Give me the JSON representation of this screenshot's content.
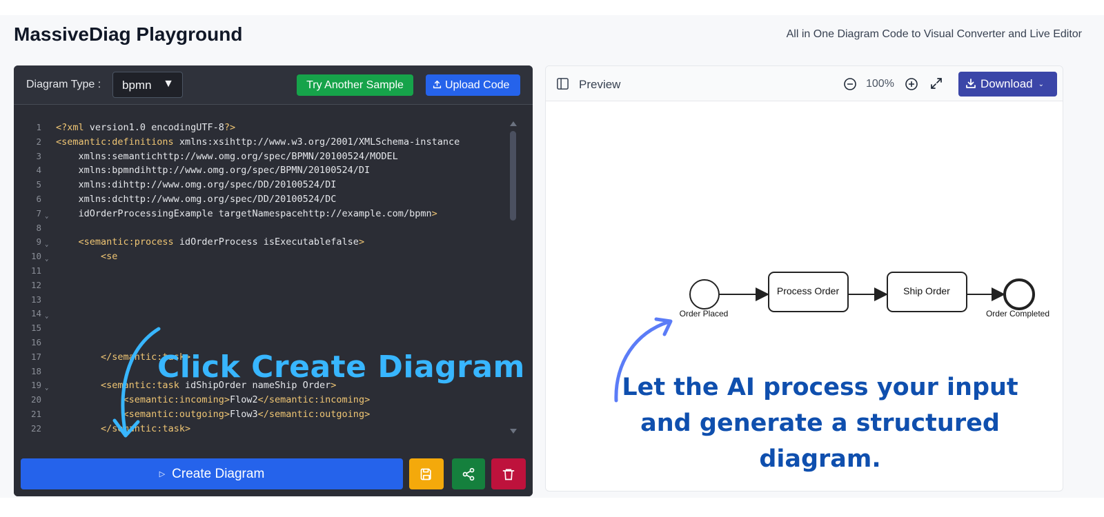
{
  "header": {
    "title": "MassiveDiag Playground",
    "subtitle": "All in One Diagram Code to Visual Converter and Live Editor"
  },
  "editor": {
    "diagram_type_label": "Diagram Type :",
    "diagram_type_value": "bpmn",
    "try_sample_label": "Try Another Sample",
    "upload_label": "Upload Code",
    "create_label": "Create Diagram",
    "overlay_text": "Click Create Diagram",
    "lines": [
      {
        "n": "1",
        "fold": "",
        "code": "<?xml version=\"1.0\" encoding=\"UTF-8\"?>"
      },
      {
        "n": "2",
        "fold": "",
        "code": "<semantic:definitions xmlns:xsi=\"http://www.w3.org/2001/XMLSchema-instance\""
      },
      {
        "n": "3",
        "fold": "",
        "code": "    xmlns:semantic=\"http://www.omg.org/spec/BPMN/20100524/MODEL\""
      },
      {
        "n": "4",
        "fold": "",
        "code": "    xmlns:bpmndi=\"http://www.omg.org/spec/BPMN/20100524/DI\""
      },
      {
        "n": "5",
        "fold": "",
        "code": "    xmlns:di=\"http://www.omg.org/spec/DD/20100524/DI\""
      },
      {
        "n": "6",
        "fold": "",
        "code": "    xmlns:dc=\"http://www.omg.org/spec/DD/20100524/DC\""
      },
      {
        "n": "7",
        "fold": "v",
        "code": "    id=\"OrderProcessingExample\" targetNamespace=\"http://example.com/bpmn\">"
      },
      {
        "n": "8",
        "fold": "",
        "code": ""
      },
      {
        "n": "9",
        "fold": "v",
        "code": "    <semantic:process id=\"OrderProcess\" isExecutable=\"false\">"
      },
      {
        "n": "10",
        "fold": "v",
        "code": "        <se"
      },
      {
        "n": "11",
        "fold": "",
        "code": ""
      },
      {
        "n": "12",
        "fold": "",
        "code": "        <"
      },
      {
        "n": "13",
        "fold": "",
        "code": ""
      },
      {
        "n": "14",
        "fold": "v",
        "code": "        <"
      },
      {
        "n": "15",
        "fold": "",
        "code": ""
      },
      {
        "n": "16",
        "fold": "",
        "code": ""
      },
      {
        "n": "17",
        "fold": "",
        "code": "        </semantic:task>"
      },
      {
        "n": "18",
        "fold": "",
        "code": ""
      },
      {
        "n": "19",
        "fold": "v",
        "code": "        <semantic:task id=\"ShipOrder\" name=\"Ship Order\">"
      },
      {
        "n": "20",
        "fold": "",
        "code": "            <semantic:incoming>Flow2</semantic:incoming>"
      },
      {
        "n": "21",
        "fold": "",
        "code": "            <semantic:outgoing>Flow3</semantic:outgoing>"
      },
      {
        "n": "22",
        "fold": "",
        "code": "        </semantic:task>"
      }
    ]
  },
  "preview": {
    "label": "Preview",
    "zoom": "100%",
    "download_label": "Download",
    "overlay_caption": "Let the AI process your input and generate a structured diagram.",
    "nodes": {
      "start_label": "Order Placed",
      "task1_label": "Process Order",
      "task2_label": "Ship Order",
      "end_label": "Order Completed"
    }
  },
  "colors": {
    "editor_bg": "#2b2d35",
    "create_button": "#2563eb",
    "try_sample_button": "#16a34a",
    "save_button": "#f4a90b",
    "share_button": "#15803d",
    "delete_button": "#be123c",
    "download_button": "#3b46a8",
    "overlay_title": "#38b6ff",
    "overlay_caption": "#0f4fae"
  },
  "icons": [
    "sidebar-icon",
    "zoom-out-icon",
    "zoom-in-icon",
    "expand-icon",
    "download-icon",
    "upload-icon",
    "save-icon",
    "share-icon",
    "trash-icon",
    "play-icon",
    "chevron-down-icon"
  ]
}
